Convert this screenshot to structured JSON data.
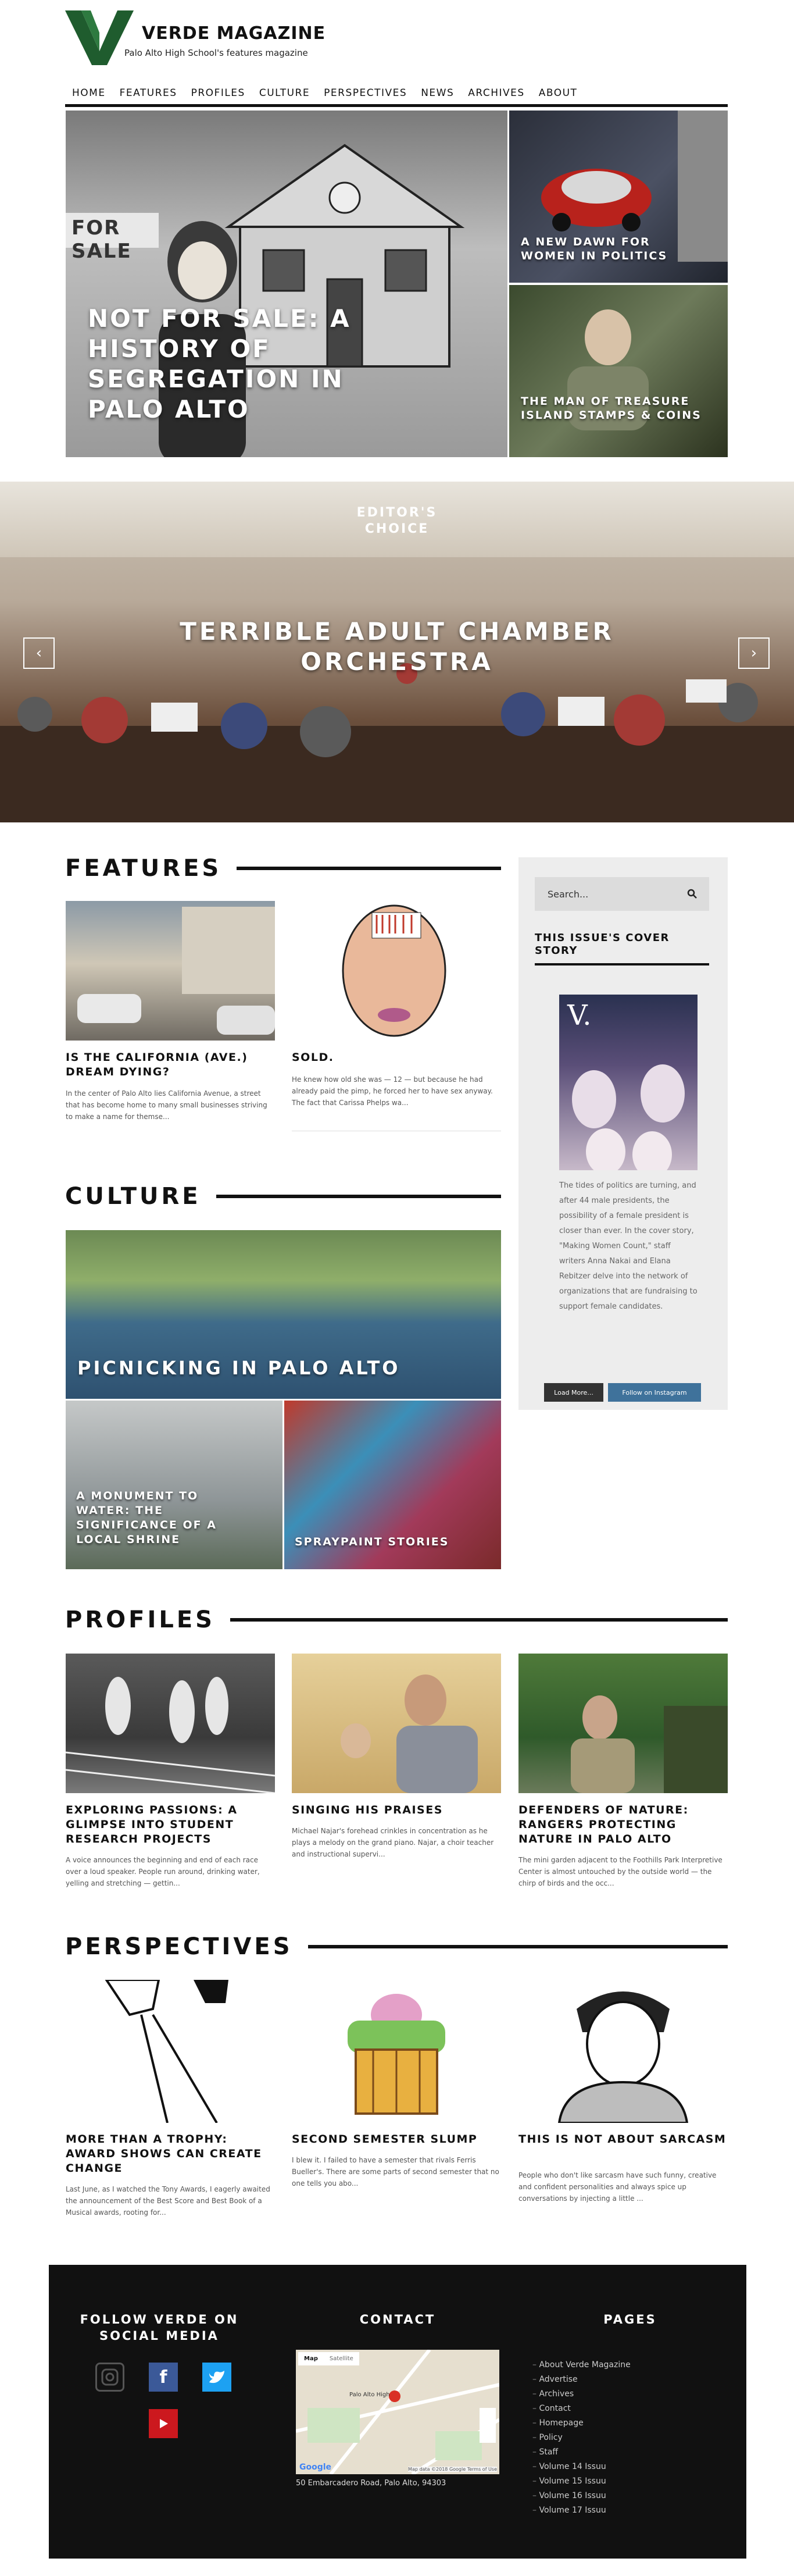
{
  "header": {
    "logo_letter": "V",
    "title": "VERDE MAGAZINE",
    "subtitle": "Palo Alto High School's features magazine"
  },
  "nav": [
    "HOME",
    "FEATURES",
    "PROFILES",
    "CULTURE",
    "PERSPECTIVES",
    "NEWS",
    "ARCHIVES",
    "ABOUT"
  ],
  "hero": {
    "main_title": "NOT FOR SALE: A HISTORY OF SEGREGATION IN PALO ALTO",
    "main_sign": "FOR SALE",
    "side": [
      {
        "title": "A NEW DAWN FOR WOMEN IN POLITICS"
      },
      {
        "title": "THE MAN OF TREASURE ISLAND STAMPS & COINS"
      }
    ]
  },
  "editors_choice": {
    "label": "EDITOR'S CHOICE",
    "title": "TERRIBLE ADULT CHAMBER ORCHESTRA",
    "prev": "‹",
    "next": "›"
  },
  "features": {
    "heading": "FEATURES",
    "cards": [
      {
        "title": "IS THE CALIFORNIA (AVE.) DREAM DYING?",
        "excerpt": "In the center of Palo Alto lies California Avenue, a street that has become home to many small businesses striving to make a name for themse..."
      },
      {
        "title": "SOLD.",
        "excerpt": "He knew how old she was — 12 — but because he had already paid the pimp, he forced her to have sex anyway. The fact that Carissa Phelps wa..."
      }
    ]
  },
  "sidebar": {
    "search_placeholder": "Search...",
    "cover_heading": "THIS ISSUE'S COVER STORY",
    "cover_letter": "V.",
    "cover_text": "The tides of politics are turning, and after 44 male presidents, the possibility of a female president is closer than ever. In the cover story, \"Making Women Count,\" staff writers Anna Nakai and Elana Rebitzer delve into the network of organizations that are fundraising to support female candidates.",
    "load_more": "Load More...",
    "follow_instagram": "Follow on Instagram"
  },
  "culture": {
    "heading": "CULTURE",
    "main_title": "PICNICKING IN PALO ALTO",
    "cards": [
      {
        "title": "A MONUMENT TO WATER: THE SIGNIFICANCE OF A LOCAL SHRINE"
      },
      {
        "title": "SPRAYPAINT STORIES"
      }
    ]
  },
  "profiles": {
    "heading": "PROFILES",
    "cards": [
      {
        "title": "EXPLORING PASSIONS: A GLIMPSE INTO STUDENT RESEARCH PROJECTS",
        "excerpt": "A voice announces the beginning and end of each race over a loud speaker. People run around, drinking water, yelling and stretching — gettin..."
      },
      {
        "title": "SINGING HIS PRAISES",
        "excerpt": "Michael Najar's forehead crinkles in concentration as he plays a melody on the grand piano. Najar, a choir teacher and instructional supervi..."
      },
      {
        "title": "DEFENDERS OF NATURE: RANGERS PROTECTING NATURE IN PALO ALTO",
        "excerpt": "The mini garden adjacent to the Foothills Park Interpretive Center is almost untouched by the outside world — the chirp of birds and the occ..."
      }
    ]
  },
  "perspectives": {
    "heading": "PERSPECTIVES",
    "cards": [
      {
        "title": "MORE THAN A TROPHY: AWARD SHOWS CAN CREATE CHANGE",
        "excerpt": "Last June, as I watched the Tony Awards, I eagerly awaited the announcement of the Best Score and Best Book of a Musical awards, rooting for..."
      },
      {
        "title": "SECOND SEMESTER SLUMP",
        "excerpt": "I blew it. I failed to have a semester that rivals Ferris Bueller's. There are some parts of second semester that no one tells you abo..."
      },
      {
        "title": "THIS IS NOT ABOUT SARCASM",
        "excerpt": "People who don't like sarcasm have such funny, creative and confident personalities and always spice up conversations by injecting a little ..."
      }
    ]
  },
  "footer": {
    "social_heading": "FOLLOW VERDE ON SOCIAL MEDIA",
    "social_facebook": "f",
    "contact_heading": "CONTACT",
    "map_tabs": [
      "Map",
      "Satellite"
    ],
    "map_pin_label": "Palo Alto High",
    "map_brand": "Google",
    "map_footer": "Map data ©2018 Google   Terms of Use",
    "address": "50 Embarcadero Road, Palo Alto, 94303",
    "pages_heading": "PAGES",
    "pages": [
      "About Verde Magazine",
      "Advertise",
      "Archives",
      "Contact",
      "Homepage",
      "Policy",
      "Staff",
      "Volume 14 Issuu",
      "Volume 15 Issuu",
      "Volume 16 Issuu",
      "Volume 17 Issuu"
    ]
  },
  "colors": {
    "brand_green": "#1f5c2e",
    "black": "#111111",
    "facebook": "#3b5998",
    "twitter": "#1da1f2",
    "youtube": "#cc181e",
    "instagram_button": "#3f729b"
  }
}
